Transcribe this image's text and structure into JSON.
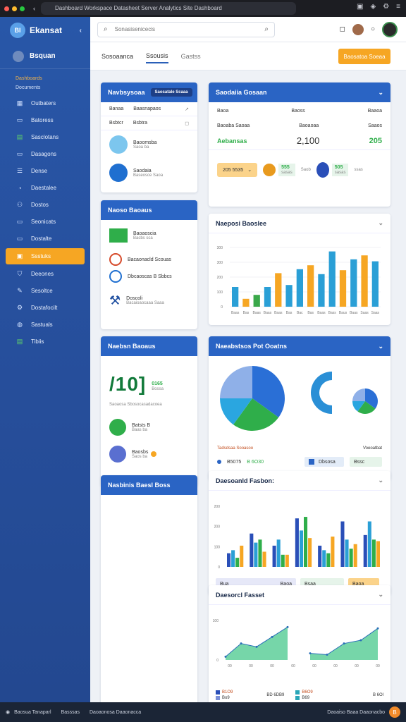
{
  "window": {
    "url": "Dashboard Workspace Datasheet Server Analytics Site Dashboard"
  },
  "sidebar": {
    "brand": "Ekansat",
    "logo": "BI",
    "profile": "Bsquan",
    "section_title": "Dashboards",
    "section_sub": "Documents",
    "items": [
      {
        "label": "Outbaters",
        "icon": "grid-icon"
      },
      {
        "label": "Batoress",
        "icon": "doc-icon"
      },
      {
        "label": "Sasclotans",
        "icon": "chart-icon"
      },
      {
        "label": "Dasagons",
        "icon": "doc-icon"
      },
      {
        "label": "Dense",
        "icon": "list-icon"
      },
      {
        "label": "Daestalee",
        "icon": "chat-icon"
      },
      {
        "label": "Dostos",
        "icon": "users-icon"
      },
      {
        "label": "Seonicats",
        "icon": "doc-icon"
      },
      {
        "label": "Dostalte",
        "icon": "doc-icon"
      },
      {
        "label": "Ssstuks",
        "icon": "folder-icon"
      },
      {
        "label": "Deeones",
        "icon": "shield-icon"
      },
      {
        "label": "Sesoltce",
        "icon": "tool-icon"
      },
      {
        "label": "Dostafocilt",
        "icon": "settings-icon"
      },
      {
        "label": "Sastuals",
        "icon": "globe-icon"
      },
      {
        "label": "Tibiis",
        "icon": "chart-icon"
      }
    ]
  },
  "topbar": {
    "search_placeholder": "Sonasisenicecis"
  },
  "tabs": [
    "Sosoaanca",
    "Ssousis",
    "Gastss"
  ],
  "export_label": "Baosatoa Soeaa",
  "card_a": {
    "title": "Navbsysoaa",
    "pill": "Saosatale Scaaa",
    "row1": [
      "Banaa",
      "Baasnapaos"
    ],
    "row2": [
      "Bsbtcr",
      "Bsbtra"
    ],
    "item1": {
      "name": "Baoomsba",
      "sub": "Saoa ba"
    },
    "item2": {
      "name": "Saodaia",
      "sub": "Baseosce Saoa"
    }
  },
  "card_b": {
    "title": "Saodaiia Gosaan",
    "headers": [
      "Baoa",
      "Baoss",
      "Baaoa"
    ],
    "labels": [
      "Baoaba Saoaa",
      "Baoaoaa",
      "Saaos"
    ],
    "kpi_label": "Aebansas",
    "kpi_value": "2,100",
    "kpi_right": "205",
    "badge": "205 5535",
    "badge_a": "555",
    "badge_a_sub": "sasas",
    "badge_b": "Saob",
    "badge_c": "505",
    "badge_c_sub": "sasas",
    "badge_d": "ssas"
  },
  "card_c": {
    "title": "Naoso Baoaus",
    "items": [
      {
        "name": "Baoaoscia",
        "sub": "Bacbs sca",
        "icon": "envelope-icon"
      },
      {
        "name": "Bacaonacld Scouas",
        "sub": "",
        "icon": "globe-icon"
      },
      {
        "name": "Dbcaoscas B Sbbcs",
        "sub": "",
        "icon": "globe-icon"
      },
      {
        "name": "Doscoli",
        "sub": "Bacaioaocaaa Saaa",
        "icon": "wrench-icon"
      }
    ]
  },
  "card_d": {
    "title": "Naeposi Baoslee",
    "chart_data": {
      "type": "bar",
      "title": "Naeposi Baoslee",
      "categories": [
        "Baas",
        "Bas",
        "Baas",
        "Baas",
        "Baas",
        "Bas",
        "Bac",
        "Bas",
        "Baas",
        "Bass",
        "Baus",
        "Baas",
        "Saas",
        "Saas"
      ],
      "values": [
        100,
        40,
        60,
        100,
        170,
        110,
        190,
        210,
        165,
        280,
        185,
        240,
        260,
        230
      ],
      "colors": [
        "#2a9fd6",
        "#f6a623",
        "#3aa84a",
        "#2a9fd6",
        "#f6a623",
        "#2a9fd6",
        "#2a9fd6",
        "#f6a623",
        "#2a9fd6",
        "#2a9fd6",
        "#f6a623",
        "#2a9fd6",
        "#f6a623",
        "#2a9fd6"
      ],
      "yticks": [
        "0",
        "100",
        "200",
        "300",
        "300"
      ],
      "ylim": [
        0,
        300
      ]
    }
  },
  "card_e": {
    "title": "Naebsn Baoaus",
    "big_value": "/10]",
    "big_side": "0165",
    "big_side_sub": "Bossa",
    "desc": "Saoaosa Sbosocasadacoea",
    "item1": {
      "name": "Batsts B",
      "sub": "Baas ba"
    },
    "item2": {
      "name": "Baosbs",
      "sub": "Saos ba"
    }
  },
  "card_f": {
    "title": "Naeabstsos Pot Ooatns",
    "chart_data": {
      "type": "pie",
      "slices": [
        {
          "label": "A",
          "value": 35,
          "color": "#2a6fd6"
        },
        {
          "label": "B",
          "value": 25,
          "color": "#2fae4a"
        },
        {
          "label": "C",
          "value": 15,
          "color": "#2aa6e0"
        },
        {
          "label": "D",
          "value": 25,
          "color": "#8fb0e8"
        }
      ]
    },
    "caption_left": "Tadsdsaa Sooasoo",
    "caption_right": "Voeoatbat",
    "legend": [
      {
        "label": "Dbsosa",
        "color": "#2a64c4"
      },
      {
        "label": "Bssc",
        "color": "#2fae4a"
      }
    ],
    "footer_left": "B5075",
    "footer_mid": "B 6O30"
  },
  "card_g": {
    "title": "Nasbinis Baesl Boss"
  },
  "card_h": {
    "title": "Daesoanld Fasbon:",
    "chart_data": {
      "type": "bar",
      "title": "Daesoanld Fasbon:",
      "series": [
        {
          "name": "Bua",
          "color": "#2a4fb8",
          "values": [
            45,
            110,
            70,
            160,
            70,
            150,
            105
          ]
        },
        {
          "name": "Bass",
          "color": "#2a9fd6",
          "values": [
            55,
            80,
            90,
            120,
            55,
            90,
            150
          ]
        },
        {
          "name": "Baoa",
          "color": "#2fae4a",
          "values": [
            30,
            90,
            40,
            165,
            45,
            60,
            90
          ]
        },
        {
          "name": "Saaa",
          "color": "#f6a623",
          "values": [
            70,
            50,
            40,
            95,
            100,
            75,
            85
          ]
        }
      ],
      "yticks": [
        "0",
        "100",
        "200",
        "200"
      ],
      "ylim": [
        0,
        200
      ]
    },
    "legend": [
      "Bua",
      "Baoa",
      "Bsaa",
      "Baoa"
    ]
  },
  "card_i": {
    "title": "Daesorcl Fasset",
    "chart_data": {
      "type": "area",
      "title": "Daesorcl Fasset",
      "series": [
        {
          "name": "A",
          "values": [
            5,
            25,
            20,
            35,
            50
          ]
        },
        {
          "name": "B",
          "values": [
            10,
            8,
            25,
            30,
            48
          ]
        }
      ],
      "xticks": [
        "00",
        "00",
        "00",
        "00",
        "00",
        "00",
        "00",
        "00"
      ],
      "yticks": [
        "0",
        "100"
      ],
      "ylim": [
        0,
        60
      ]
    },
    "legend": [
      "B1O9",
      "Bo9",
      "B6O9",
      "B69"
    ],
    "legend_mid": "BD 6DB9",
    "legend_right": "B 6Ol"
  },
  "footer": {
    "left": "Baosua Tanaparl",
    "mid": "Basssas",
    "mid2": "Daoaonosa Daaonacca",
    "right": "Daoaiso Baaa Daaonacbo",
    "badge": "B"
  }
}
